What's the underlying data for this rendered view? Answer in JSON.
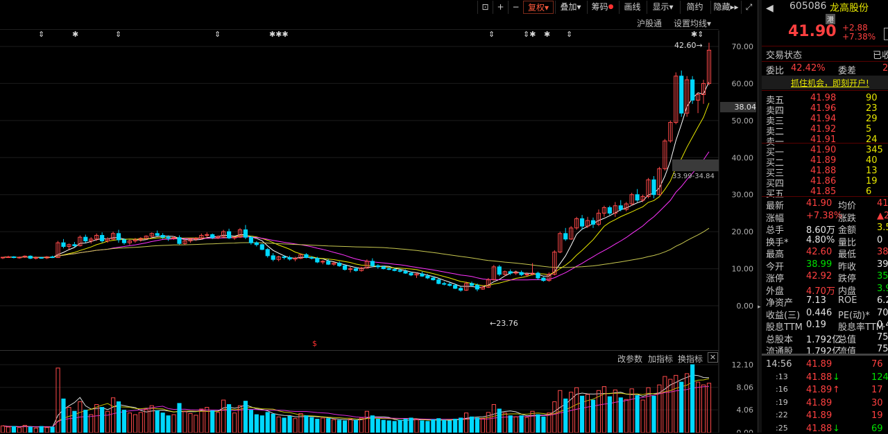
{
  "toolbar": {
    "buttons": [
      "复权",
      "叠加",
      "筹码",
      "画线",
      "显示",
      "简约",
      "隐藏"
    ],
    "icons": [
      "lock-icon",
      "plus-icon",
      "minus-icon",
      "expand-icon"
    ]
  },
  "subbar": {
    "hgt": "沪股通",
    "ma_setting": "设置均线"
  },
  "chart_labels": {
    "high": "42.60",
    "low": "23.76",
    "price_box": "38.04",
    "range_label": "33.99-34.84",
    "s_marker": "$"
  },
  "y_ticks": [
    "70.00",
    "60.00",
    "50.00",
    "40.00",
    "30.00",
    "20.00",
    "10.00",
    "0.00"
  ],
  "vol_ticks": [
    "12.10",
    "8.06",
    "4.06",
    "0.00"
  ],
  "lower_bar": {
    "change_params": "改参数",
    "add_indicator": "加指标",
    "switch_indicator": "换指标"
  },
  "stock": {
    "code": "605086",
    "name": "龙高股份",
    "hk_tag": "港",
    "price": "41.90",
    "change": "+2.88",
    "change_pct": "+7.38%",
    "status_label": "交易状态",
    "status_value": "已收",
    "wei_bi_label": "委比",
    "wei_bi": "42.42%",
    "wei_cha_label": "委差",
    "wei_cha": "2",
    "promo": "抓住机会，即刻开户!"
  },
  "sell_orders": [
    {
      "label": "卖五",
      "price": "41.98",
      "vol": "90"
    },
    {
      "label": "卖四",
      "price": "41.96",
      "vol": "23"
    },
    {
      "label": "卖三",
      "price": "41.94",
      "vol": "29"
    },
    {
      "label": "卖二",
      "price": "41.92",
      "vol": "5"
    },
    {
      "label": "卖一",
      "price": "41.91",
      "vol": "24"
    }
  ],
  "buy_orders": [
    {
      "label": "买一",
      "price": "41.90",
      "vol": "345"
    },
    {
      "label": "买二",
      "price": "41.89",
      "vol": "40"
    },
    {
      "label": "买三",
      "price": "41.88",
      "vol": "13"
    },
    {
      "label": "买四",
      "price": "41.86",
      "vol": "19"
    },
    {
      "label": "买五",
      "price": "41.85",
      "vol": "6"
    }
  ],
  "stats": [
    {
      "l1": "最新",
      "v1": "41.90",
      "c1": "red",
      "l2": "均价",
      "v2": "41",
      "c2": "red"
    },
    {
      "l1": "涨幅",
      "v1": "+7.38%",
      "c1": "red",
      "l2": "涨跌",
      "v2": "▲2",
      "c2": "red"
    },
    {
      "l1": "总手",
      "v1": "8.60万",
      "c1": "wht",
      "l2": "金额",
      "v2": "3.5",
      "c2": "yel"
    },
    {
      "l1": "换手*",
      "v1": "4.80%",
      "c1": "wht",
      "l2": "量比",
      "v2": "0",
      "c2": "wht"
    },
    {
      "l1": "最高",
      "v1": "42.60",
      "c1": "red",
      "l2": "最低",
      "v2": "38",
      "c2": "red"
    },
    {
      "l1": "今开",
      "v1": "38.99",
      "c1": "grn",
      "l2": "昨收",
      "v2": "39",
      "c2": "wht"
    },
    {
      "l1": "涨停",
      "v1": "42.92",
      "c1": "red",
      "l2": "跌停",
      "v2": "35",
      "c2": "grn"
    },
    {
      "l1": "外盘",
      "v1": "4.70万",
      "c1": "red",
      "l2": "内盘",
      "v2": "3.9",
      "c2": "grn"
    },
    {
      "l1": "净资产",
      "v1": "7.13",
      "c1": "wht",
      "l2": "ROE",
      "v2": "6.2",
      "c2": "wht"
    },
    {
      "l1": "收益(三)",
      "v1": "0.446",
      "c1": "wht",
      "l2": "PE(动)*",
      "v2": "70",
      "c2": "wht"
    },
    {
      "l1": "股息TTM",
      "v1": "0.19",
      "c1": "wht",
      "l2": "股息率TTM",
      "v2": "0.4",
      "c2": "wht"
    },
    {
      "l1": "总股本",
      "v1": "1.792亿",
      "c1": "wht",
      "l2": "总值",
      "v2": "75.0",
      "c2": "wht"
    },
    {
      "l1": "流通股",
      "v1": "1.792亿",
      "c1": "wht",
      "l2": "流值",
      "v2": "75.0",
      "c2": "wht"
    }
  ],
  "ticks": [
    {
      "time": "14:56",
      "price": "41.89",
      "arrow": "",
      "vol": "76",
      "vc": "red"
    },
    {
      "time": ":13",
      "price": "41.88",
      "arrow": "↓",
      "vol": "124",
      "vc": "grn"
    },
    {
      "time": ":16",
      "price": "41.89",
      "arrow": "↑",
      "vol": "17",
      "vc": "red"
    },
    {
      "time": ":19",
      "price": "41.89",
      "arrow": "",
      "vol": "30",
      "vc": "red"
    },
    {
      "time": ":22",
      "price": "41.89",
      "arrow": "",
      "vol": "19",
      "vc": "red"
    },
    {
      "time": ":25",
      "price": "41.88",
      "arrow": "↓",
      "vol": "69",
      "vc": "grn"
    }
  ],
  "chart_data": {
    "type": "candlestick",
    "y_range": [
      0,
      70
    ],
    "candles": [
      [
        13.0,
        13.2,
        12.6,
        13.1
      ],
      [
        13.1,
        13.5,
        12.9,
        13.2
      ],
      [
        13.2,
        13.4,
        12.8,
        13.0
      ],
      [
        13.0,
        13.3,
        12.7,
        13.1
      ],
      [
        13.1,
        13.6,
        12.9,
        13.4
      ],
      [
        13.4,
        13.6,
        12.6,
        12.8
      ],
      [
        12.8,
        13.3,
        12.5,
        13.0
      ],
      [
        13.0,
        13.2,
        12.7,
        12.9
      ],
      [
        12.9,
        13.4,
        12.6,
        13.2
      ],
      [
        13.2,
        13.5,
        12.9,
        13.0
      ],
      [
        13.0,
        17.5,
        12.9,
        17.0
      ],
      [
        17.0,
        18.0,
        15.5,
        16.0
      ],
      [
        16.0,
        16.8,
        15.2,
        16.5
      ],
      [
        16.5,
        17.2,
        15.8,
        16.2
      ],
      [
        16.2,
        19.0,
        16.0,
        18.5
      ],
      [
        18.5,
        19.2,
        17.0,
        17.5
      ],
      [
        17.5,
        18.5,
        16.8,
        18.0
      ],
      [
        18.0,
        19.5,
        17.5,
        19.0
      ],
      [
        19.0,
        19.8,
        17.0,
        17.5
      ],
      [
        17.5,
        18.5,
        17.0,
        18.0
      ],
      [
        18.0,
        20.0,
        17.8,
        19.5
      ],
      [
        19.5,
        20.5,
        17.0,
        17.8
      ],
      [
        17.8,
        18.2,
        16.5,
        17.0
      ],
      [
        17.0,
        17.8,
        16.4,
        17.5
      ],
      [
        17.5,
        18.3,
        17.0,
        17.8
      ],
      [
        17.8,
        18.5,
        17.3,
        18.2
      ],
      [
        18.2,
        19.0,
        17.8,
        18.8
      ],
      [
        18.8,
        19.8,
        18.2,
        19.5
      ],
      [
        19.5,
        20.3,
        18.8,
        19.0
      ],
      [
        19.0,
        19.6,
        18.0,
        18.5
      ],
      [
        18.5,
        19.0,
        17.5,
        18.2
      ],
      [
        18.2,
        18.8,
        17.8,
        18.4
      ],
      [
        18.4,
        19.0,
        16.5,
        16.8
      ],
      [
        16.8,
        18.0,
        16.5,
        17.5
      ],
      [
        17.5,
        18.2,
        17.0,
        18.0
      ],
      [
        18.0,
        18.5,
        17.5,
        18.2
      ],
      [
        18.2,
        19.5,
        17.8,
        19.0
      ],
      [
        19.0,
        19.8,
        18.5,
        19.2
      ],
      [
        19.2,
        19.5,
        18.0,
        18.4
      ],
      [
        18.4,
        19.0,
        18.0,
        18.7
      ],
      [
        18.7,
        20.5,
        18.5,
        20.0
      ],
      [
        20.0,
        20.8,
        18.0,
        18.3
      ],
      [
        18.3,
        18.7,
        17.8,
        18.5
      ],
      [
        18.5,
        21.0,
        18.3,
        20.5
      ],
      [
        20.5,
        21.8,
        18.0,
        18.5
      ],
      [
        18.5,
        18.8,
        16.5,
        17.0
      ],
      [
        17.0,
        17.4,
        16.0,
        16.5
      ],
      [
        16.5,
        16.8,
        15.0,
        15.2
      ],
      [
        15.2,
        15.6,
        13.0,
        13.5
      ],
      [
        13.5,
        14.2,
        12.0,
        12.5
      ],
      [
        12.5,
        13.5,
        12.0,
        13.2
      ],
      [
        13.2,
        13.7,
        12.5,
        13.0
      ],
      [
        13.0,
        13.5,
        12.2,
        12.6
      ],
      [
        12.6,
        13.2,
        12.0,
        12.8
      ],
      [
        12.8,
        14.0,
        12.6,
        13.8
      ],
      [
        13.8,
        14.2,
        12.8,
        13.0
      ],
      [
        13.0,
        13.4,
        12.5,
        12.8
      ],
      [
        12.8,
        13.2,
        11.5,
        11.8
      ],
      [
        11.8,
        12.3,
        11.2,
        12.0
      ],
      [
        12.0,
        12.6,
        11.0,
        11.2
      ],
      [
        11.2,
        11.8,
        10.8,
        11.5
      ],
      [
        11.5,
        12.0,
        10.5,
        10.8
      ],
      [
        10.8,
        11.2,
        9.5,
        9.8
      ],
      [
        9.8,
        10.5,
        9.0,
        10.0
      ],
      [
        10.0,
        10.5,
        9.2,
        9.5
      ],
      [
        9.5,
        10.5,
        9.2,
        10.2
      ],
      [
        10.2,
        12.5,
        10.0,
        12.0
      ],
      [
        12.0,
        12.8,
        10.5,
        10.8
      ],
      [
        10.8,
        11.2,
        10.0,
        10.5
      ],
      [
        10.5,
        10.8,
        9.8,
        10.0
      ],
      [
        10.0,
        10.4,
        9.6,
        9.8
      ],
      [
        9.8,
        10.2,
        9.3,
        9.5
      ],
      [
        9.5,
        10.0,
        9.0,
        9.3
      ],
      [
        9.3,
        9.8,
        8.6,
        8.8
      ],
      [
        8.8,
        9.2,
        8.0,
        8.3
      ],
      [
        8.3,
        8.9,
        7.5,
        8.6
      ],
      [
        8.6,
        9.2,
        7.8,
        8.0
      ],
      [
        8.0,
        8.6,
        7.2,
        7.5
      ],
      [
        7.5,
        8.0,
        6.8,
        7.0
      ],
      [
        7.0,
        7.4,
        5.8,
        6.0
      ],
      [
        6.0,
        6.5,
        5.5,
        5.8
      ],
      [
        5.8,
        6.3,
        5.2,
        5.5
      ],
      [
        5.5,
        6.0,
        4.5,
        4.7
      ],
      [
        4.7,
        5.2,
        3.8,
        4.2
      ],
      [
        4.2,
        6.5,
        4.0,
        6.0
      ],
      [
        6.0,
        6.5,
        5.2,
        5.5
      ],
      [
        5.5,
        6.0,
        3.9,
        4.5
      ],
      [
        4.5,
        5.5,
        4.3,
        5.0
      ],
      [
        5.0,
        7.5,
        4.8,
        7.0
      ],
      [
        7.0,
        11.0,
        6.8,
        10.5
      ],
      [
        10.5,
        11.0,
        8.0,
        8.5
      ],
      [
        8.5,
        9.5,
        8.0,
        9.2
      ],
      [
        9.2,
        9.8,
        8.3,
        8.8
      ],
      [
        8.8,
        9.5,
        8.3,
        9.0
      ],
      [
        9.0,
        9.5,
        8.0,
        8.4
      ],
      [
        8.4,
        9.0,
        7.8,
        8.5
      ],
      [
        8.5,
        11.5,
        8.2,
        8.8
      ],
      [
        8.8,
        9.2,
        7.0,
        7.5
      ],
      [
        7.5,
        7.8,
        6.5,
        6.8
      ],
      [
        6.8,
        9.0,
        6.5,
        8.5
      ],
      [
        8.5,
        15.0,
        8.2,
        14.5
      ],
      [
        14.5,
        20.0,
        14.2,
        19.5
      ],
      [
        19.5,
        21.0,
        17.5,
        18.0
      ],
      [
        18.0,
        21.5,
        17.8,
        21.0
      ],
      [
        21.0,
        24.0,
        20.5,
        23.5
      ],
      [
        23.5,
        24.5,
        20.5,
        21.5
      ],
      [
        21.5,
        24.0,
        21.0,
        23.0
      ],
      [
        23.0,
        23.8,
        21.0,
        22.0
      ],
      [
        22.0,
        26.0,
        21.5,
        25.0
      ],
      [
        25.0,
        27.0,
        24.0,
        26.5
      ],
      [
        26.5,
        27.0,
        24.5,
        25.0
      ],
      [
        25.0,
        28.0,
        24.0,
        27.0
      ],
      [
        27.0,
        28.5,
        25.5,
        26.0
      ],
      [
        26.0,
        28.0,
        25.5,
        27.5
      ],
      [
        27.5,
        30.5,
        27.0,
        30.0
      ],
      [
        30.0,
        31.5,
        28.0,
        28.5
      ],
      [
        28.5,
        30.0,
        28.0,
        29.5
      ],
      [
        29.5,
        34.5,
        29.0,
        34.0
      ],
      [
        34.0,
        35.0,
        29.0,
        30.0
      ],
      [
        30.0,
        37.5,
        29.8,
        37.0
      ],
      [
        37.0,
        45.0,
        36.5,
        44.5
      ],
      [
        44.5,
        50.0,
        44.0,
        49.5
      ],
      [
        49.5,
        63.0,
        49.0,
        62.0
      ],
      [
        62.0,
        63.5,
        51.0,
        52.0
      ],
      [
        52.0,
        62.0,
        51.0,
        61.0
      ],
      [
        61.0,
        62.0,
        54.5,
        55.5
      ],
      [
        55.5,
        57.5,
        52.0,
        57.0
      ],
      [
        57.0,
        61.0,
        54.5,
        60.0
      ],
      [
        60.0,
        71.0,
        59.5,
        69.0
      ]
    ],
    "volume_range": [
      0,
      12.1
    ],
    "volumes": [
      1.2,
      1.0,
      1.1,
      0.9,
      1.3,
      1.0,
      0.8,
      1.1,
      0.9,
      1.0,
      11.5,
      6.0,
      4.5,
      3.8,
      5.5,
      4.0,
      3.2,
      5.0,
      4.5,
      3.8,
      6.2,
      5.5,
      4.0,
      3.5,
      3.2,
      3.6,
      4.1,
      4.8,
      3.9,
      3.5,
      3.0,
      3.2,
      5.2,
      3.8,
      3.4,
      3.1,
      4.2,
      4.5,
      3.9,
      3.6,
      5.8,
      5.0,
      3.5,
      4.8,
      5.6,
      4.0,
      3.2,
      3.0,
      3.6,
      3.3,
      2.8,
      2.6,
      2.9,
      2.5,
      3.4,
      3.0,
      2.7,
      2.4,
      2.6,
      2.5,
      2.3,
      2.2,
      2.1,
      2.4,
      2.2,
      2.6,
      3.8,
      3.0,
      2.4,
      2.2,
      2.1,
      2.0,
      2.2,
      2.4,
      2.6,
      2.3,
      2.1,
      2.0,
      2.3,
      2.5,
      2.2,
      2.1,
      2.4,
      2.6,
      3.5,
      2.8,
      2.6,
      2.5,
      3.6,
      5.0,
      4.2,
      3.5,
      3.0,
      2.8,
      3.0,
      2.7,
      3.8,
      3.2,
      2.8,
      3.5,
      5.5,
      7.5,
      6.0,
      7.2,
      8.0,
      6.5,
      6.8,
      5.8,
      7.5,
      8.2,
      6.4,
      7.6,
      6.2,
      5.9,
      7.8,
      6.6,
      5.8,
      8.0,
      6.5,
      8.5,
      10.0,
      9.5,
      10.2,
      9.0,
      10.5,
      12.1,
      9.0,
      8.5,
      8.8
    ]
  }
}
